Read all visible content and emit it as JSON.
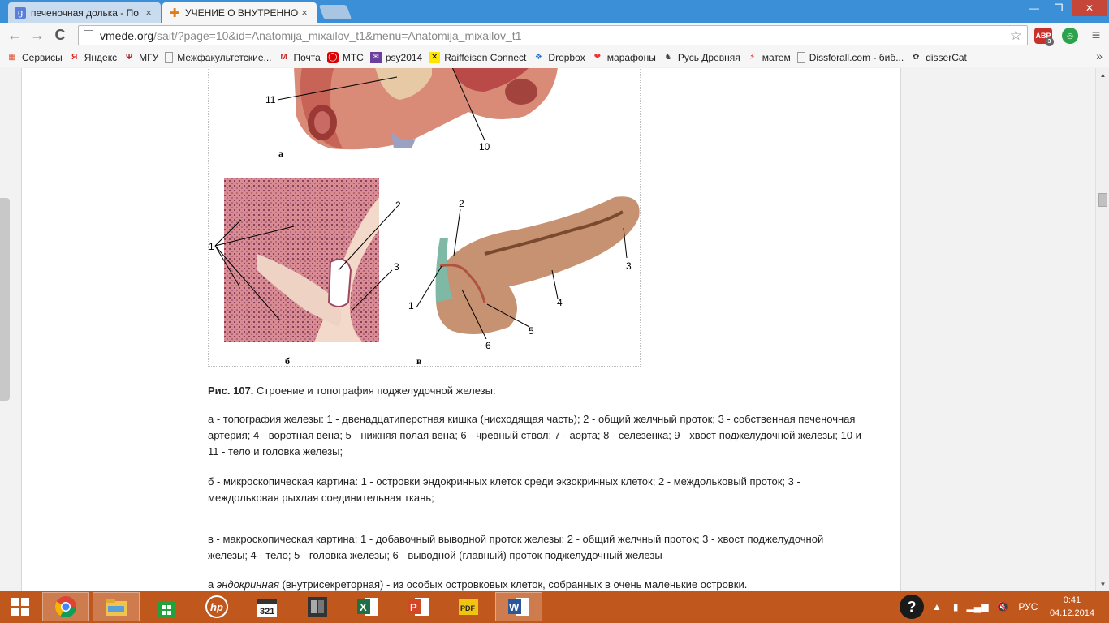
{
  "tabs": [
    {
      "title": "печеночная долька - По",
      "favicon": "google-favicon-icon",
      "close": "×",
      "active": false
    },
    {
      "title": "УЧЕНИЕ О ВНУТРЕННОС",
      "favicon": "medical-cross-favicon-icon",
      "close": "×",
      "active": true
    }
  ],
  "window_controls": {
    "minimize": "—",
    "restore": "❐",
    "close": "✕"
  },
  "nav": {
    "back": "←",
    "forward": "→",
    "reload": "C"
  },
  "address": {
    "host": "vmede.org",
    "path": "/sait/?page=10&id=Anatomija_mixailov_t1&menu=Anatomija_mixailov_t1"
  },
  "extensions": {
    "abp_label": "ABP",
    "abp_count": "3",
    "menu": "≡"
  },
  "bookmarks": [
    {
      "label": "Сервисы",
      "icon": "apps-grid-icon"
    },
    {
      "label": "Яндекс",
      "icon": "yandex-icon"
    },
    {
      "label": "МГУ",
      "icon": "psi-icon"
    },
    {
      "label": "Межфакультетские...",
      "icon": "page-icon"
    },
    {
      "label": "Почта",
      "icon": "gmail-icon"
    },
    {
      "label": "МТС",
      "icon": "mts-icon"
    },
    {
      "label": "psy2014",
      "icon": "mail-envelope-icon"
    },
    {
      "label": "Raiffeisen Connect",
      "icon": "raiffeisen-icon"
    },
    {
      "label": "Dropbox",
      "icon": "dropbox-icon"
    },
    {
      "label": "марафоны",
      "icon": "marathon-icon"
    },
    {
      "label": "Русь Древняя",
      "icon": "rus-icon"
    },
    {
      "label": "матем",
      "icon": "lightning-icon"
    },
    {
      "label": "Dissforall.com - биб...",
      "icon": "page-icon"
    },
    {
      "label": "disserCat",
      "icon": "dissercat-icon"
    }
  ],
  "bookmarks_more": "»",
  "figure": {
    "panel_labels": {
      "a": "а",
      "b": "б",
      "v": "в"
    },
    "labels_a": [
      "11",
      "10"
    ],
    "labels_b": [
      "1",
      "2",
      "3"
    ],
    "labels_v": [
      "2",
      "1",
      "3",
      "4",
      "5",
      "6"
    ]
  },
  "caption": {
    "fig_num": "Рис. 107.",
    "fig_title": " Строение и топография поджелудочной железы:",
    "para_a": "а - топография железы: 1 - двенадцатиперстная кишка (нисходящая часть); 2 - общий желчный проток; 3 - собственная печеночная артерия; 4 - воротная вена; 5 - нижняя полая вена; 6 - чревный ствол; 7 - аорта; 8 - селезенка; 9 - хвост поджелудочной железы; 10 и 11 - тело и головка железы;",
    "para_b": "б - микроскопическая картина: 1 - островки эндокринных клеток среди экзокринных клеток; 2 - междольковый проток; 3 - междольковая рыхлая соединительная ткань;",
    "para_v": "в - макроскопическая картина: 1 - добавочный выводной проток железы; 2 - общий желчный проток; 3 - хвост поджелудочной железы; 4 - тело; 5 - головка железы; 6 - выводной (главный) проток поджелудочный железы",
    "para_end_pre": "а ",
    "para_end_em": "эндокринная",
    "para_end_post": " (внутрисекреторная) - из особых островковых клеток, собранных в очень маленькие островки."
  },
  "scrollbar": {
    "up": "▲",
    "down": "▼"
  },
  "taskbar": {
    "apps": [
      "windows-start-icon",
      "chrome-icon",
      "file-explorer-icon",
      "store-icon",
      "hp-icon",
      "calendar-321-icon",
      "media-icon",
      "excel-icon",
      "powerpoint-icon",
      "pdf-icon",
      "word-icon"
    ],
    "lang": "РУС",
    "time": "0:41",
    "date": "04.12.2014"
  },
  "colors": {
    "titlebar": "#3a8fd6",
    "taskbar": "#c0571d"
  }
}
